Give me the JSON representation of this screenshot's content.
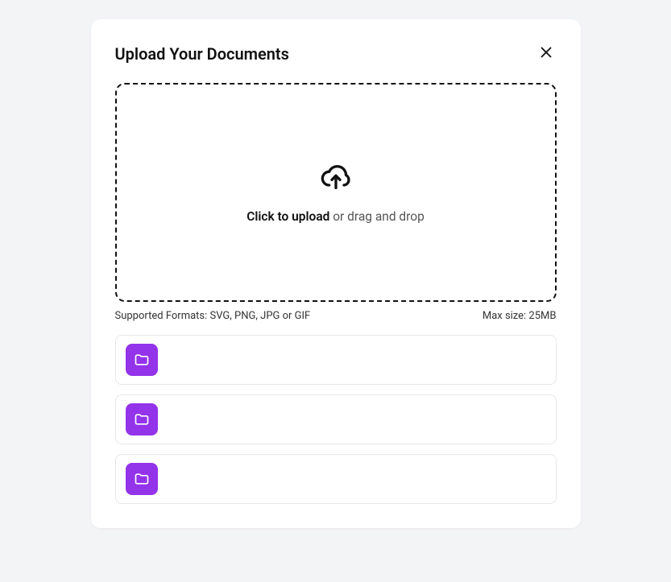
{
  "dialog": {
    "title": "Upload Your Documents"
  },
  "dropzone": {
    "strong_text": "Click to upload",
    "rest_text": " or drag and drop"
  },
  "meta": {
    "formats": "Supported Formats: SVG, PNG, JPG or GIF",
    "maxsize": "Max size: 25MB"
  },
  "files": [
    {
      "name": ""
    },
    {
      "name": ""
    },
    {
      "name": ""
    }
  ]
}
